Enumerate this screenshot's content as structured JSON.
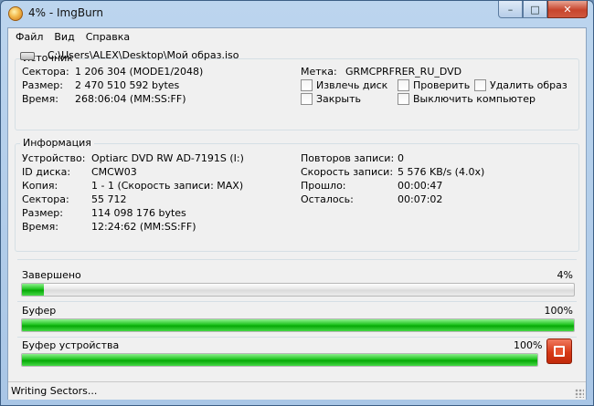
{
  "window": {
    "title": "4% - ImgBurn"
  },
  "menu": {
    "items": [
      "Файл",
      "Вид",
      "Справка"
    ]
  },
  "source": {
    "title": "Источник",
    "path": "C:\\Users\\ALEX\\Desktop\\Мой образ.iso",
    "sectors_label": "Сектора:",
    "sectors_value": "1 206 304 (MODE1/2048)",
    "size_label": "Размер:",
    "size_value": "2 470 510 592 bytes",
    "time_label": "Время:",
    "time_value": "268:06:04 (MM:SS:FF)",
    "label_label": "Метка:",
    "label_value": "GRMCPRFRER_RU_DVD",
    "options": {
      "eject": "Извлечь диск",
      "verify": "Проверить",
      "delete_image": "Удалить образ",
      "close": "Закрыть",
      "shutdown": "Выключить компьютер"
    }
  },
  "info": {
    "title": "Информация",
    "device_label": "Устройство:",
    "device_value": "Optiarc DVD RW AD-7191S (I:)",
    "disc_id_label": "ID диска:",
    "disc_id_value": "CMCW03",
    "copy_label": "Копия:",
    "copy_value": "1 - 1 (Скорость записи: MAX)",
    "sectors_label": "Сектора:",
    "sectors_value": "55 712",
    "size_label": "Размер:",
    "size_value": "114 098 176 bytes",
    "time_label": "Время:",
    "time_value": "12:24:62 (MM:SS:FF)",
    "retries_label": "Повторов записи:",
    "retries_value": "0",
    "speed_label": "Скорость записи:",
    "speed_value": "5 576 KB/s (4.0x)",
    "elapsed_label": "Прошло:",
    "elapsed_value": "00:00:47",
    "remaining_label": "Осталось:",
    "remaining_value": "00:07:02"
  },
  "progress": {
    "complete_label": "Завершено",
    "complete_text": "4%",
    "complete_fraction": 0.04,
    "buffer_label": "Буфер",
    "buffer_text": "100%",
    "buffer_fraction": 1.0,
    "device_buffer_label": "Буфер устройства",
    "device_buffer_text": "100%",
    "device_buffer_fraction": 1.0
  },
  "status": {
    "text": "Writing Sectors..."
  },
  "colors": {
    "progress_green": "#1fc41f",
    "stop_red": "#d63816"
  },
  "icons": {
    "app": "imgburn-icon",
    "drive": "drive-icon",
    "stop": "stop-icon"
  }
}
